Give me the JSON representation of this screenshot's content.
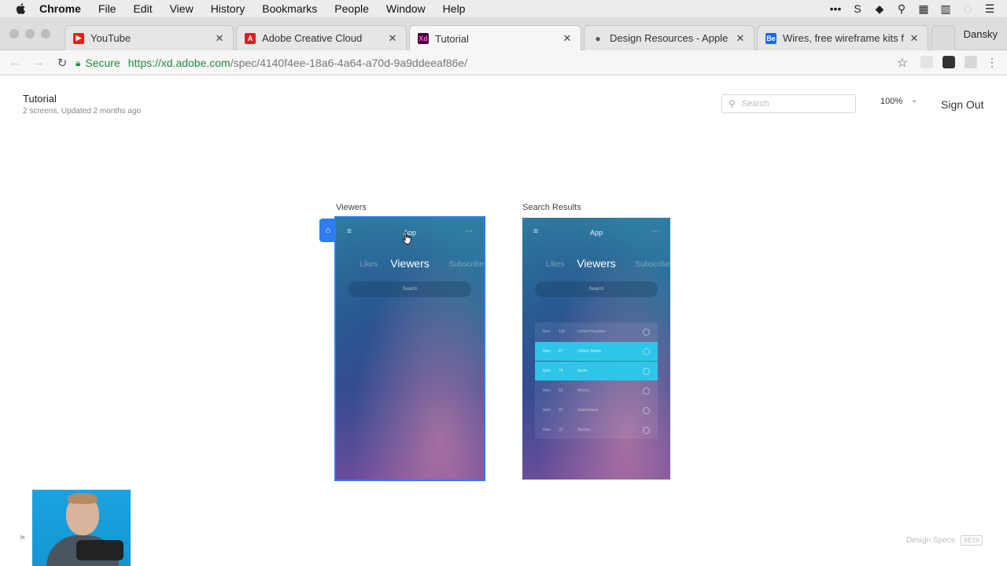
{
  "menubar": {
    "items": [
      "Chrome",
      "File",
      "Edit",
      "View",
      "History",
      "Bookmarks",
      "People",
      "Window",
      "Help"
    ]
  },
  "tabs": [
    {
      "label": "YouTube",
      "favicon": "youtube-icon",
      "color": "#e62117",
      "active": false
    },
    {
      "label": "Adobe Creative Cloud",
      "favicon": "adobe-icon",
      "color": "#da1f26",
      "active": false
    },
    {
      "label": "Tutorial",
      "favicon": "adobe-xd-icon",
      "color": "#470137",
      "active": true
    },
    {
      "label": "Design Resources - Apple De",
      "favicon": "apple-icon",
      "color": "#555555",
      "active": false
    },
    {
      "label": "Wires, free wireframe kits for",
      "favicon": "behance-icon",
      "color": "#1769ff",
      "active": false
    }
  ],
  "profile": "Dansky",
  "address": {
    "secure_label": "Secure",
    "url_host": "https://xd.adobe.com",
    "url_path": "/spec/4140f4ee-18a6-4a64-a70d-9a9ddeeaf86e/"
  },
  "page": {
    "title": "Tutorial",
    "subtitle": "2 screens, Updated 2 months ago",
    "search_placeholder": "Search",
    "zoom": "100%",
    "sign_out": "Sign Out"
  },
  "artboards": [
    {
      "label": "Viewers",
      "app": "App",
      "likes": "Likes",
      "title": "Viewers",
      "subs": "Subscribe",
      "search": "Search"
    },
    {
      "label": "Search Results",
      "app": "App",
      "likes": "Likes",
      "title": "Viewers",
      "subs": "Subscribe",
      "search": "Search",
      "rows": [
        {
          "c1": "Item",
          "c2": "100",
          "c3": "United Kingdom",
          "highlighted": false
        },
        {
          "c1": "Item",
          "c2": "87",
          "c3": "United States",
          "highlighted": true
        },
        {
          "c1": "Item",
          "c2": "74",
          "c3": "Spain",
          "highlighted": true
        },
        {
          "c1": "Item",
          "c2": "55",
          "c3": "Mexico",
          "highlighted": false
        },
        {
          "c1": "Item",
          "c2": "42",
          "c3": "Switzerland",
          "highlighted": false
        },
        {
          "c1": "Item",
          "c2": "30",
          "c3": "Austria",
          "highlighted": false
        }
      ]
    }
  ],
  "footer": {
    "design_specs": "Design Specs",
    "beta": "BETA"
  },
  "colors": {
    "selection": "#2d7cf0",
    "row_highlight": "#2ec6e8",
    "secure_green": "#1e8e3e"
  }
}
